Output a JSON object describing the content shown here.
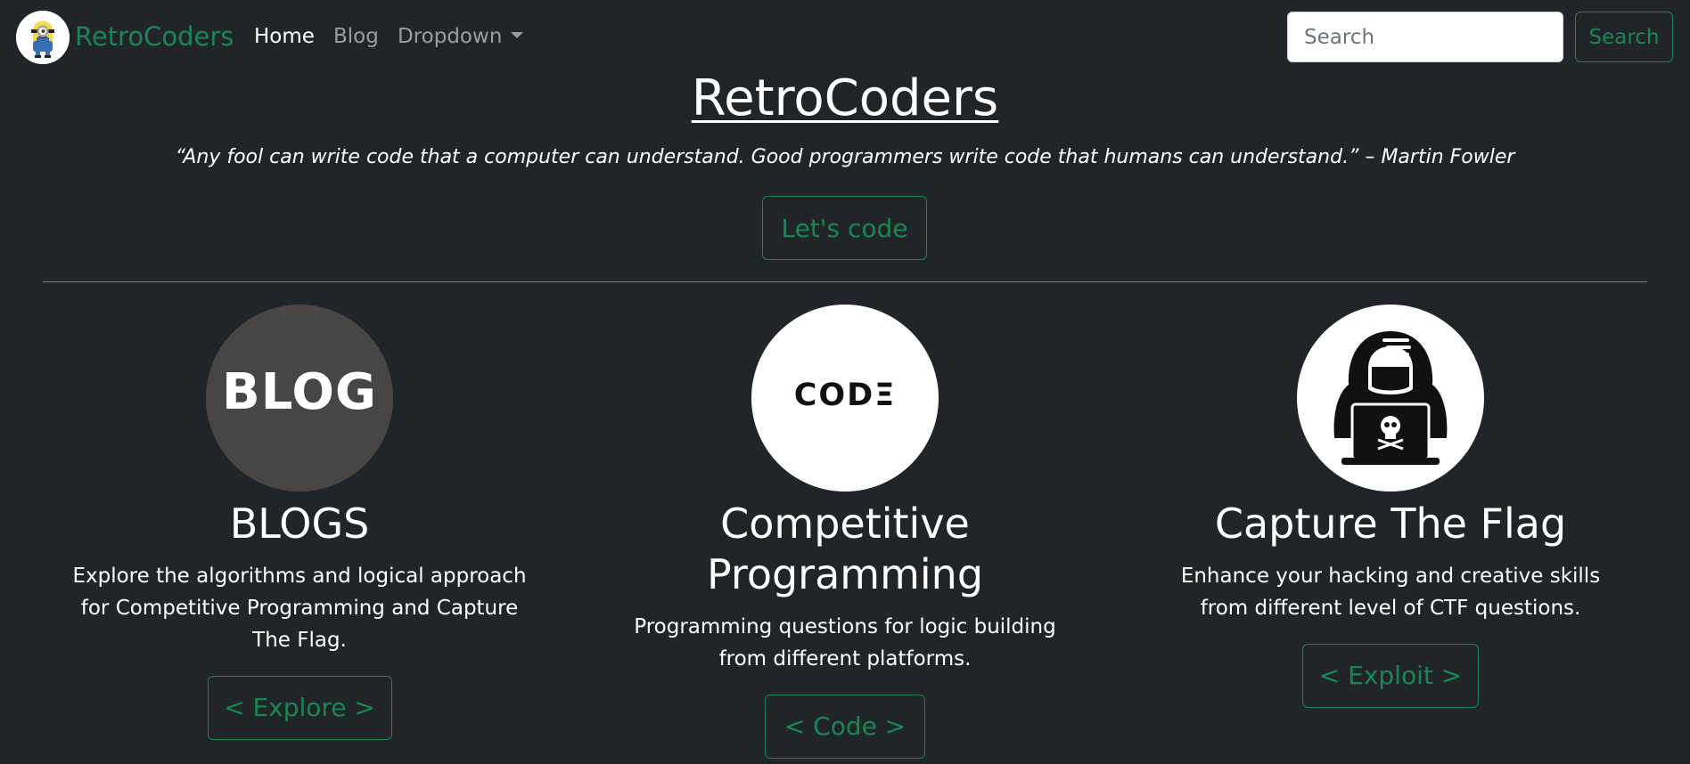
{
  "navbar": {
    "brand": "RetroCoders",
    "links": [
      {
        "label": "Home"
      },
      {
        "label": "Blog"
      },
      {
        "label": "Dropdown"
      }
    ],
    "search": {
      "placeholder": "Search",
      "button_label": "Search"
    }
  },
  "hero": {
    "title": "RetroCoders",
    "quote": "“Any fool can write code that a computer can understand. Good programmers write code that humans can understand.” – Martin Fowler",
    "button_label": "Let's code"
  },
  "cards": [
    {
      "image_text": "BLOG",
      "heading": "BLOGS",
      "text": "Explore the algorithms and logical approach for Competitive Programming and Capture The Flag.",
      "button_label": "< Explore >"
    },
    {
      "image_text": "CODΞ",
      "heading": "Competitive Programming",
      "text": "Programming questions for logic building from different platforms.",
      "button_label": "< Code >"
    },
    {
      "image_text": "",
      "heading": "Capture The Flag",
      "text": "Enhance your hacking and creative skills from different level of CTF questions.",
      "button_label": "< Exploit >"
    }
  ],
  "colors": {
    "background": "#212529",
    "accent": "#198754",
    "text": "#ffffff",
    "nav_muted": "rgba(255,255,255,0.55)"
  },
  "icons": [
    "minion-logo-icon",
    "blog-image-icon",
    "code-image-icon",
    "hooded-hacker-icon",
    "caret-down-icon"
  ]
}
